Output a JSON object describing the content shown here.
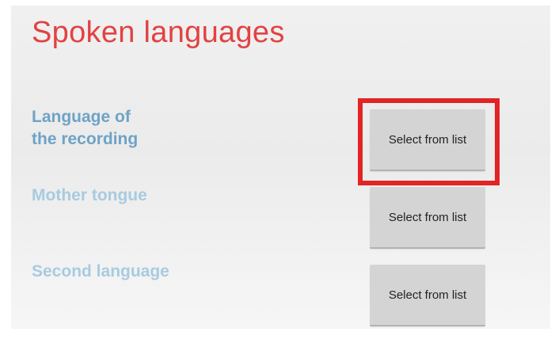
{
  "page": {
    "title": "Spoken languages"
  },
  "fields": [
    {
      "label": "Language of\nthe recording",
      "label_line1": "Language of",
      "label_line2": "the recording",
      "button_label": "Select from list"
    },
    {
      "label": "Mother tongue",
      "button_label": "Select from list"
    },
    {
      "label": "Second language",
      "button_label": "Select from list"
    }
  ],
  "colors": {
    "title": "#e24242",
    "active_label": "#6ea3c6",
    "inactive_label": "#a8cbe0",
    "button_bg": "#d4d4d4",
    "highlight": "#e32424"
  }
}
